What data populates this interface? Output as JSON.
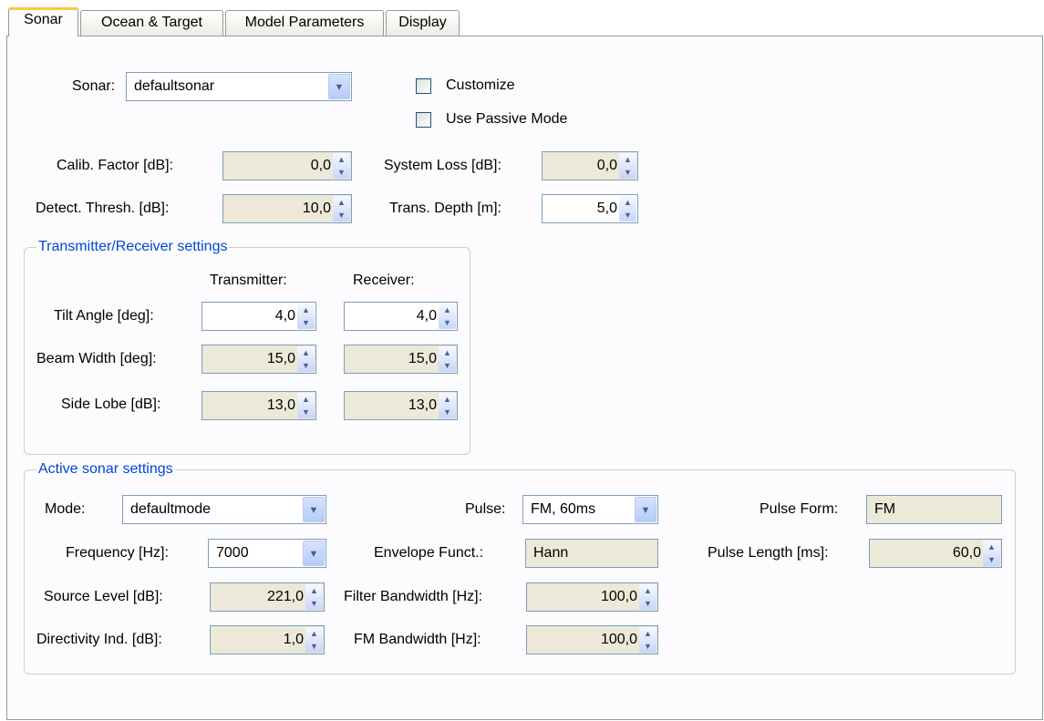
{
  "tabs": [
    {
      "label": "Sonar"
    },
    {
      "label": "Ocean & Target"
    },
    {
      "label": "Model Parameters"
    },
    {
      "label": "Display"
    }
  ],
  "sonar": {
    "label": "Sonar:",
    "value": "defaultsonar",
    "customize_label": "Customize",
    "passive_label": "Use Passive Mode"
  },
  "fields": {
    "calib_label": "Calib. Factor [dB]:",
    "calib_value": "0,0",
    "system_loss_label": "System Loss [dB]:",
    "system_loss_value": "0,0",
    "detect_label": "Detect. Thresh. [dB]:",
    "detect_value": "10,0",
    "trans_depth_label": "Trans. Depth [m]:",
    "trans_depth_value": "5,0"
  },
  "txrx": {
    "title": "Transmitter/Receiver settings",
    "transmitter_header": "Transmitter:",
    "receiver_header": "Receiver:",
    "tilt_label": "Tilt Angle [deg]:",
    "tilt_tx": "4,0",
    "tilt_rx": "4,0",
    "beam_label": "Beam Width [deg]:",
    "beam_tx": "15,0",
    "beam_rx": "15,0",
    "side_label": "Side Lobe [dB]:",
    "side_tx": "13,0",
    "side_rx": "13,0"
  },
  "active": {
    "title": "Active sonar settings",
    "mode_label": "Mode:",
    "mode_value": "defaultmode",
    "pulse_label": "Pulse:",
    "pulse_value": "FM, 60ms",
    "pulse_form_label": "Pulse Form:",
    "pulse_form_value": "FM",
    "frequency_label": "Frequency [Hz]:",
    "frequency_value": "7000",
    "envelope_label": "Envelope Funct.:",
    "envelope_value": "Hann",
    "pulse_length_label": "Pulse Length [ms]:",
    "pulse_length_value": "60,0",
    "source_level_label": "Source Level [dB]:",
    "source_level_value": "221,0",
    "filter_bw_label": "Filter Bandwidth [Hz]:",
    "filter_bw_value": "100,0",
    "directivity_label": "Directivity Ind. [dB]:",
    "directivity_value": "1,0",
    "fm_bw_label": "FM Bandwidth [Hz]:",
    "fm_bw_value": "100,0"
  }
}
